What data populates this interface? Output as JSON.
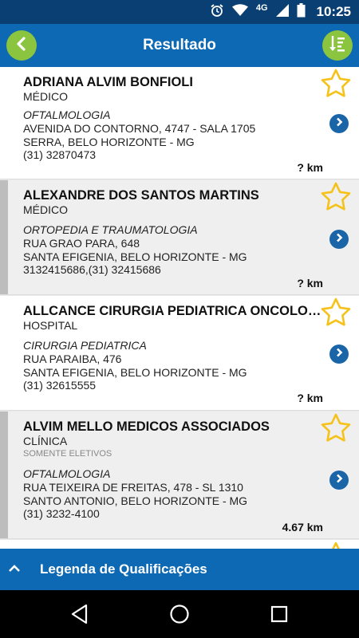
{
  "statusbar": {
    "network": "4G",
    "time": "10:25"
  },
  "appbar": {
    "title": "Resultado"
  },
  "results": [
    {
      "name": "ADRIANA ALVIM BONFIOLI",
      "type": "MÉDICO",
      "specialty": "OFTALMOLOGIA",
      "address": "AVENIDA DO CONTORNO, 4747 - SALA 1705",
      "city": "SERRA, BELO HORIZONTE - MG",
      "phone": "(31) 32870473",
      "distance": "? km",
      "bar_color": "#ffffff",
      "bg_color": "#ffffff"
    },
    {
      "name": "ALEXANDRE DOS SANTOS MARTINS",
      "type": "MÉDICO",
      "specialty": "ORTOPEDIA E TRAUMATOLOGIA",
      "address": "RUA GRAO PARA, 648",
      "city": "SANTA EFIGENIA, BELO HORIZONTE - MG",
      "phone": "3132415686,(31) 32415686",
      "distance": "? km",
      "bar_color": "#bdbdbd",
      "bg_color": "#efefef"
    },
    {
      "name": "ALLCANCE CIRURGIA PEDIATRICA ONCOLOGICA",
      "type": "HOSPITAL",
      "specialty": "CIRURGIA PEDIATRICA",
      "address": "RUA PARAIBA, 476",
      "city": "SANTA EFIGENIA, BELO HORIZONTE - MG",
      "phone": "(31) 32615555",
      "distance": "? km",
      "bar_color": "#ffffff",
      "bg_color": "#ffffff"
    },
    {
      "name": "ALVIM MELLO MEDICOS ASSOCIADOS",
      "type": "CLÍNICA",
      "note": "SOMENTE ELETIVOS",
      "specialty": "OFTALMOLOGIA",
      "address": "RUA TEIXEIRA DE FREITAS, 478 - SL 1310",
      "city": "SANTO ANTONIO, BELO HORIZONTE - MG",
      "phone": "(31) 3232-4100",
      "distance": "4.67 km",
      "bar_color": "#bdbdbd",
      "bg_color": "#efefef"
    }
  ],
  "legend": {
    "label": "Legenda de Qualificações"
  },
  "colors": {
    "primary": "#0d69b4",
    "status": "#0a3f73",
    "accent": "#8bc43f",
    "star": "#f5c21b",
    "arrow": "#1a64a8"
  }
}
